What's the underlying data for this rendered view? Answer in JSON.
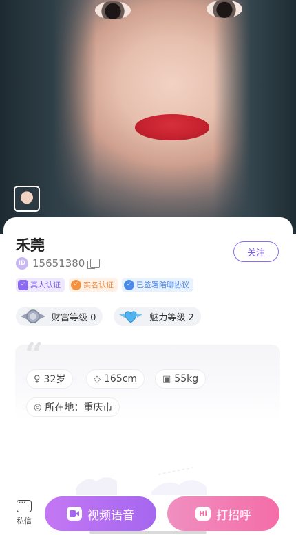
{
  "profile": {
    "name": "禾莞",
    "id_label": "ID",
    "id_value": "15651380",
    "follow_label": "关注"
  },
  "tags": [
    {
      "label": "真人认证",
      "icon": "verified-person-icon"
    },
    {
      "label": "实名认证",
      "icon": "real-name-icon"
    },
    {
      "label": "已签署陪聊协议",
      "icon": "agreement-icon"
    }
  ],
  "levels": [
    {
      "label": "财富等级 0",
      "icon": "wealth-badge-icon"
    },
    {
      "label": "魅力等级 2",
      "icon": "charm-heart-icon"
    }
  ],
  "info": {
    "age": "32岁",
    "height": "165cm",
    "weight": "55kg",
    "location": "所在地：重庆市"
  },
  "actions": {
    "message_label": "私信",
    "video_label": "视频语音",
    "greet_label": "打招呼",
    "greet_icon_text": "Hi"
  },
  "colors": {
    "accent_purple": "#8b6bf0",
    "video_button": "#b06ef2",
    "greet_button": "#f27db4"
  }
}
